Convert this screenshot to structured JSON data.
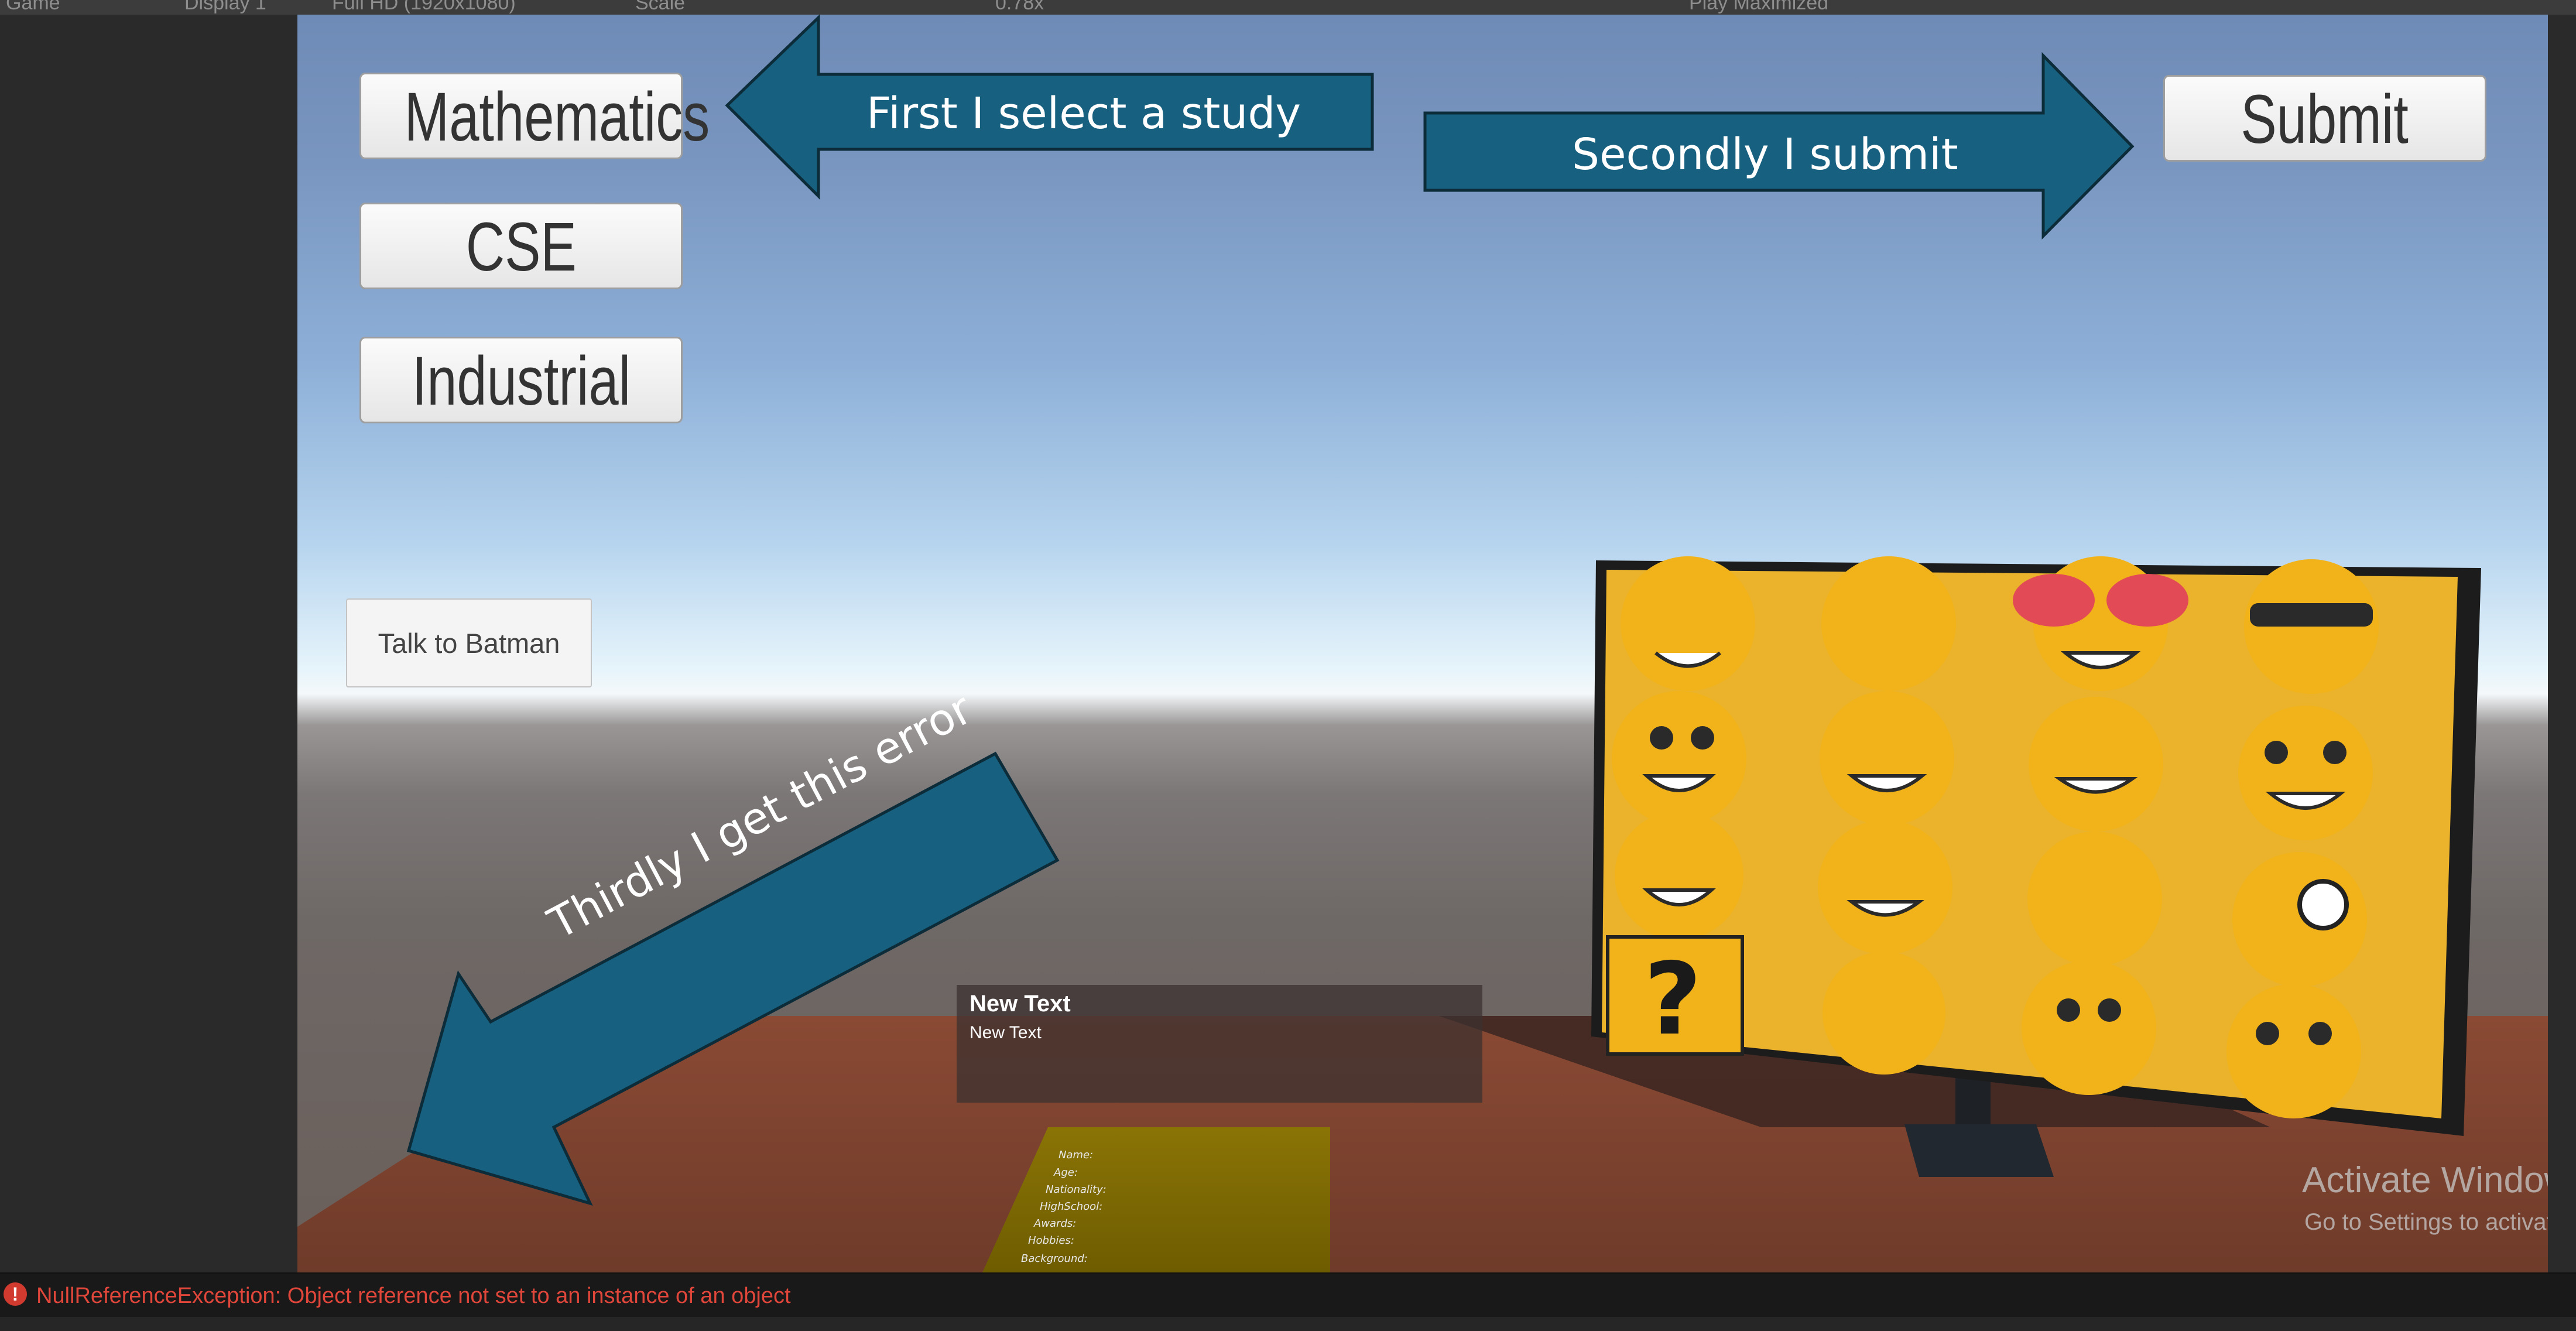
{
  "editor": {
    "toolbar": {
      "game_tab": "Game",
      "display": "Display 1",
      "resolution": "Full HD (1920x1080)",
      "scale_label": "Scale",
      "scale_value": "0.78x",
      "play_mode": "Play Maximized"
    },
    "console": {
      "error_icon": "error-icon",
      "error_message": "NullReferenceException: Object reference not set to an instance of an object"
    }
  },
  "game": {
    "study_buttons": [
      {
        "label": "Mathematics"
      },
      {
        "label": "CSE"
      },
      {
        "label": "Industrial"
      }
    ],
    "submit_label": "Submit",
    "talk_label": "Talk to Batman",
    "annotations": {
      "step1": "First I select a study",
      "step2": "Secondly I submit",
      "step3": "Thirdly I get this error"
    },
    "text_panel": {
      "title": "New Text",
      "body": "New Text"
    },
    "paper_fields": [
      "Name:",
      "Age:",
      "Nationality:",
      "HighSchool:",
      "Awards:",
      "Hobbies:",
      "Background:"
    ],
    "monitor_icons": [
      "blush-emoji",
      "tongue-emoji",
      "heart-eyes-emoji",
      "sunglasses-emoji",
      "grin-emoji",
      "big-grin-emoji",
      "tears-of-joy-emoji",
      "smile-emoji",
      "grin-emoji",
      "big-grin-emoji",
      "squint-emoji",
      "wink-tongue-emoji",
      "question-mark-icon",
      "rofl-emoji",
      "slight-smile-emoji",
      "frown-emoji"
    ],
    "watermark": {
      "line1": "Activate Windows",
      "line2": "Go to Settings to activate Windows."
    },
    "colors": {
      "annotation_arrow": "#17607f",
      "error_text": "#e0463a",
      "emoji_yellow": "#f2b31a",
      "sky_top": "#6e8ab6",
      "floor": "#7a4633"
    }
  }
}
